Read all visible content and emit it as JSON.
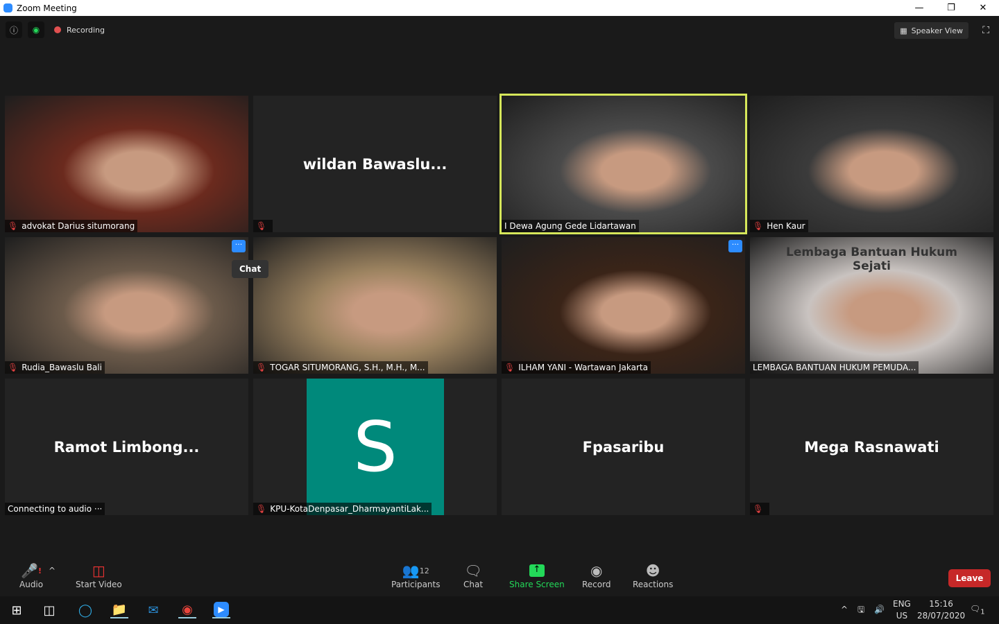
{
  "window": {
    "title": "Zoom Meeting"
  },
  "topbar": {
    "recording": "Recording",
    "view": "Speaker View"
  },
  "tiles": [
    {
      "name": "advokat Darius situmorang",
      "type": "video",
      "muted": true,
      "bg": "#6b2a1e"
    },
    {
      "name": "",
      "big": "wildan  Bawaslu...",
      "type": "name",
      "muted": true
    },
    {
      "name": "I Dewa Agung Gede Lidartawan",
      "type": "video",
      "muted": false,
      "active": true,
      "bg": "#4a4a4a"
    },
    {
      "name": "Hen Kaur",
      "type": "video",
      "muted": true,
      "bg": "#3b3b3b"
    },
    {
      "name": "Rudia_Bawaslu Bali",
      "type": "video",
      "muted": true,
      "more": true,
      "bg": "#6b5a4a"
    },
    {
      "name": "TOGAR SITUMORANG, S.H., M.H., M...",
      "type": "video",
      "muted": true,
      "bg": "#9c8360"
    },
    {
      "name": "ILHAM YANI - Wartawan Jakarta",
      "type": "video",
      "muted": true,
      "more": true,
      "bg": "#3a2418"
    },
    {
      "name": "LEMBAGA BANTUAN HUKUM PEMUDA...",
      "type": "video",
      "muted": false,
      "bg": "#c9c3c0",
      "sign": "Lembaga Bantuan Hukum Sejati"
    },
    {
      "name": "Connecting to audio ···",
      "big": "Ramot  Limbong...",
      "type": "name",
      "muted": false
    },
    {
      "name": "KPU-KotaDenpasar_DharmayantiLak...",
      "type": "avatar",
      "initial": "S",
      "muted": true
    },
    {
      "name": "",
      "big": "Fpasaribu",
      "type": "name",
      "muted": false
    },
    {
      "name": "",
      "big": "Mega Rasnawati",
      "type": "name",
      "muted": true
    }
  ],
  "tooltip": "Chat",
  "toolbar": {
    "audio": "Audio",
    "video": "Start Video",
    "participants": "Participants",
    "participants_count": "12",
    "chat": "Chat",
    "share": "Share Screen",
    "record": "Record",
    "reactions": "Reactions",
    "leave": "Leave",
    "share_color": "#23d959",
    "leave_color": "#c62828"
  },
  "taskbar": {
    "lang1": "ENG",
    "lang2": "US",
    "time": "15:16",
    "date": "28/07/2020",
    "notifications": "1"
  }
}
